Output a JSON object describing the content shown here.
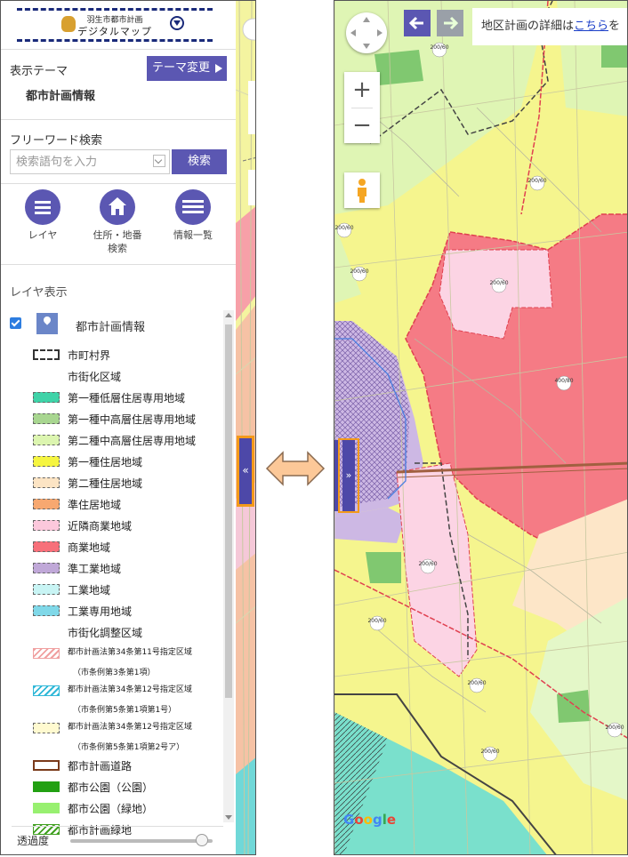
{
  "logo": {
    "small": "羽生市都市計画",
    "main": "デジタルマップ"
  },
  "theme": {
    "label": "表示テーマ",
    "change_button": "テーマ変更",
    "current": "都市計画情報"
  },
  "search": {
    "label": "フリーワード検索",
    "placeholder": "検索語句を入力",
    "button": "検索"
  },
  "nav": [
    {
      "label": "レイヤ",
      "icon": "list-icon"
    },
    {
      "label": "住所・地番検索",
      "icon": "home-icon"
    },
    {
      "label": "情報一覧",
      "icon": "info-list-icon"
    }
  ],
  "layers": {
    "title": "レイヤ表示",
    "group": "都市計画情報",
    "checked": true,
    "items": [
      {
        "label": "市町村界",
        "swatch": "border",
        "color": "#333333"
      },
      {
        "label": "市街化区域",
        "swatch": "none"
      },
      {
        "label": "第一種低層住居専用地域",
        "swatch": "fill",
        "color": "#3fd3a8"
      },
      {
        "label": "第一種中高層住居専用地域",
        "swatch": "fill",
        "color": "#a8d690"
      },
      {
        "label": "第二種中高層住居専用地域",
        "swatch": "fill",
        "color": "#dcf5b0"
      },
      {
        "label": "第一種住居地域",
        "swatch": "fill",
        "color": "#f5f540"
      },
      {
        "label": "第二種住居地域",
        "swatch": "fill",
        "color": "#fce4c4"
      },
      {
        "label": "準住居地域",
        "swatch": "fill",
        "color": "#f7a870"
      },
      {
        "label": "近隣商業地域",
        "swatch": "fill",
        "color": "#fcc8dc"
      },
      {
        "label": "商業地域",
        "swatch": "fill",
        "color": "#f7707a"
      },
      {
        "label": "準工業地域",
        "swatch": "fill",
        "color": "#c0a8d8"
      },
      {
        "label": "工業地域",
        "swatch": "fill",
        "color": "#c8f4f4"
      },
      {
        "label": "工業専用地域",
        "swatch": "fill",
        "color": "#80d8e8"
      },
      {
        "label": "市街化調整区域",
        "swatch": "none"
      },
      {
        "label": "都市計画法第34条第11号指定区域",
        "sub": "（市条例第3条第1項）",
        "swatch": "hatch",
        "color": "#f0a0a0"
      },
      {
        "label": "都市計画法第34条第12号指定区域",
        "sub": "（市条例第5条第1項第1号）",
        "swatch": "hatch",
        "color": "#30b8d8"
      },
      {
        "label": "都市計画法第34条第12号指定区域",
        "sub": "（市条例第5条第1項第2号ア）",
        "swatch": "fill",
        "color": "#fffad0"
      },
      {
        "label": "都市計画道路",
        "swatch": "road",
        "color": "#7a3a1a"
      },
      {
        "label": "都市公園（公園）",
        "swatch": "solid",
        "color": "#22a012"
      },
      {
        "label": "都市公園（緑地）",
        "swatch": "solid",
        "color": "#98f070"
      },
      {
        "label": "都市計画緑地",
        "swatch": "hatch",
        "color": "#40a020"
      }
    ]
  },
  "opacity": {
    "label": "透過度",
    "value": 0.95
  },
  "map": {
    "info_prefix": "地区計画の詳細は",
    "info_link": "こちら",
    "info_suffix": "を",
    "zoom_in": "+",
    "zoom_out": "−",
    "google": [
      "G",
      "o",
      "o",
      "g",
      "l",
      "e"
    ],
    "google_colors": [
      "#4285f4",
      "#ea4335",
      "#fbbc05",
      "#4285f4",
      "#34a853",
      "#ea4335"
    ],
    "labels": [
      "200/60",
      "200/60",
      "200/60",
      "200/60",
      "200/60",
      "400/80",
      "200/60",
      "200/60",
      "200/60",
      "200/60",
      "200/60"
    ]
  },
  "collapse_glyph": "«",
  "expand_glyph": "»"
}
